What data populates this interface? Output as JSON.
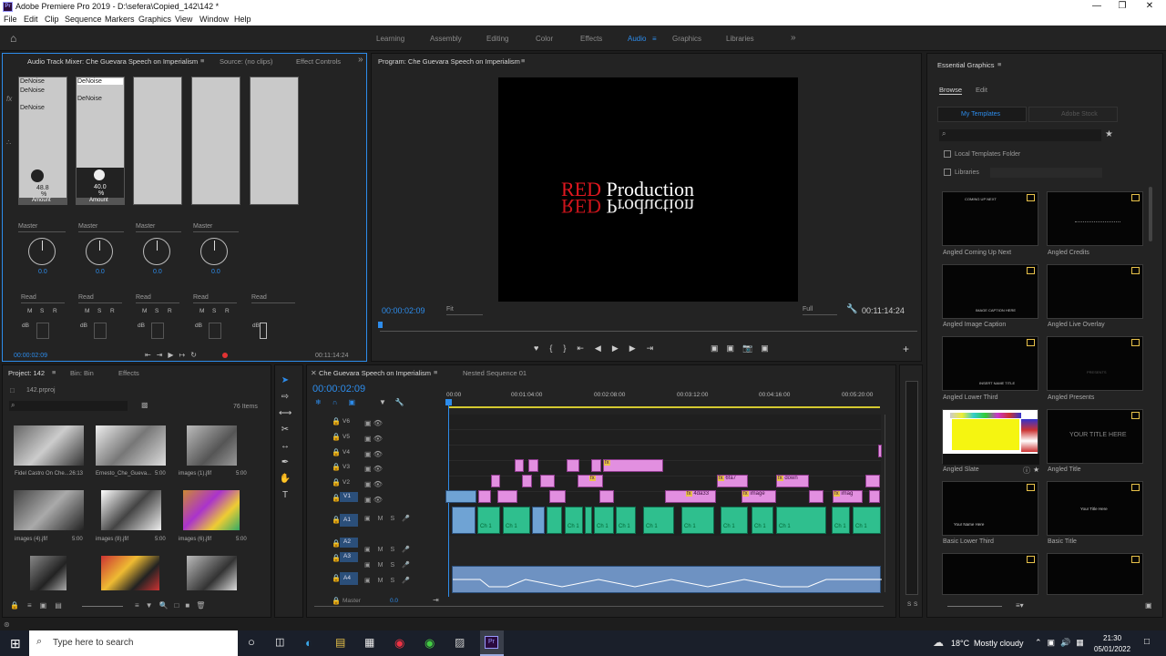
{
  "window": {
    "title": "Adobe Premiere Pro 2019 - D:\\sefera\\Copied_142\\142 *",
    "app_badge": "Pr"
  },
  "menu": [
    "File",
    "Edit",
    "Clip",
    "Sequence",
    "Markers",
    "Graphics",
    "View",
    "Window",
    "Help"
  ],
  "workspaces": [
    "Learning",
    "Assembly",
    "Editing",
    "Color",
    "Effects",
    "Audio",
    "Graphics",
    "Libraries"
  ],
  "active_workspace": "Audio",
  "mixer": {
    "tabs": [
      "Audio Track Mixer: Che Guevara Speech on Imperialism",
      "Source: (no clips)",
      "Effect Controls"
    ],
    "strips": [
      {
        "fx": [
          "DeNoise",
          "DeNoise",
          "DeNoise"
        ],
        "value": "48.8",
        "unit": "%",
        "param": "Amount",
        "route": "Master",
        "pan": "0.0",
        "mode": "Read"
      },
      {
        "fx": [
          "DeNoise",
          "DeNoise"
        ],
        "value": "40.0",
        "unit": "%",
        "param": "Amount",
        "route": "Master",
        "pan": "0.0",
        "mode": "Read"
      },
      {
        "fx": [],
        "value": "",
        "unit": "",
        "param": "",
        "route": "Master",
        "pan": "0.0",
        "mode": "Read"
      },
      {
        "fx": [],
        "value": "",
        "unit": "",
        "param": "",
        "route": "Master",
        "pan": "0.0",
        "mode": "Read"
      },
      {
        "fx": [],
        "value": "",
        "unit": "",
        "param": "",
        "route": "",
        "pan": "",
        "mode": "Read"
      }
    ],
    "msr": [
      "M",
      "S",
      "R"
    ],
    "db_label": "dB",
    "timecode_left": "00:00:02:09",
    "timecode_right": "00:11:14:24"
  },
  "program": {
    "title": "Program: Che Guevara Speech on Imperialism",
    "overlay_red": "RED",
    "overlay_white": "Production",
    "timecode": "00:00:02:09",
    "fit": "Fit",
    "quality": "Full",
    "duration": "00:11:14:24"
  },
  "project": {
    "tabs": [
      "Project: 142",
      "Bin: Bin",
      "Effects"
    ],
    "file": "142.prproj",
    "count": "76 Items",
    "items": [
      {
        "name": "Fidel Castro On Che...",
        "dur": "26:13"
      },
      {
        "name": "Ernesto_Che_Gueva...",
        "dur": "5:00"
      },
      {
        "name": "images (1).jfif",
        "dur": "5:00"
      },
      {
        "name": "images (4).jfif",
        "dur": "5:00"
      },
      {
        "name": "images (8).jfif",
        "dur": "5:00"
      },
      {
        "name": "images (6).jfif",
        "dur": "5:00"
      }
    ]
  },
  "timeline": {
    "tabs": [
      "Che Guevara Speech on Imperialism",
      "Nested Sequence 01"
    ],
    "timecode": "00:00:02:09",
    "ruler": [
      "00:00",
      "00:01:04:00",
      "00:02:08:00",
      "00:03:12:00",
      "00:04:16:00",
      "00:05:20:00"
    ],
    "video_tracks": [
      "V6",
      "V5",
      "V4",
      "V3",
      "V2",
      "V1"
    ],
    "audio_tracks": [
      "A1",
      "A2",
      "A3",
      "A4"
    ],
    "master_label": "Master",
    "master_value": "0.0",
    "clip_labels": [
      "fx",
      "6fa7",
      "down",
      "4da33",
      "image",
      "imag"
    ],
    "audio_clip_label": "Ch 1",
    "meter_labels": [
      "S",
      "S"
    ]
  },
  "essential_graphics": {
    "title": "Essential Graphics",
    "tabs": [
      "Browse",
      "Edit"
    ],
    "subtabs": [
      "My Templates",
      "Adobe Stock"
    ],
    "checkboxes": [
      "Local Templates Folder",
      "Libraries"
    ],
    "templates": [
      {
        "name": "Angled Coming Up Next",
        "preview": "COMING UP NEXT"
      },
      {
        "name": "Angled Credits",
        "preview": ""
      },
      {
        "name": "Angled Image Caption",
        "preview": "IMAGE CAPTION HERE"
      },
      {
        "name": "Angled Live Overlay",
        "preview": ""
      },
      {
        "name": "Angled Lower Third",
        "preview": "INSERT NAME TITLE"
      },
      {
        "name": "Angled Presents",
        "preview": "PRESENTS"
      },
      {
        "name": "Angled Slate",
        "preview": ""
      },
      {
        "name": "Angled Title",
        "preview": "YOUR TITLE HERE"
      },
      {
        "name": "Basic Lower Third",
        "preview": "Your Name Here"
      },
      {
        "name": "Basic Title",
        "preview": "Your Title Here"
      },
      {
        "name": "",
        "preview": ""
      },
      {
        "name": "",
        "preview": ""
      }
    ]
  },
  "taskbar": {
    "search_placeholder": "Type here to search",
    "weather_temp": "18°C",
    "weather_text": "Mostly cloudy",
    "time": "21:30",
    "date": "05/01/2022"
  },
  "colors": {
    "accent": "#2d8ceb",
    "clip_video": "#e28fe0",
    "clip_audio": "#2fbf8e",
    "red_text": "#e0171f"
  }
}
